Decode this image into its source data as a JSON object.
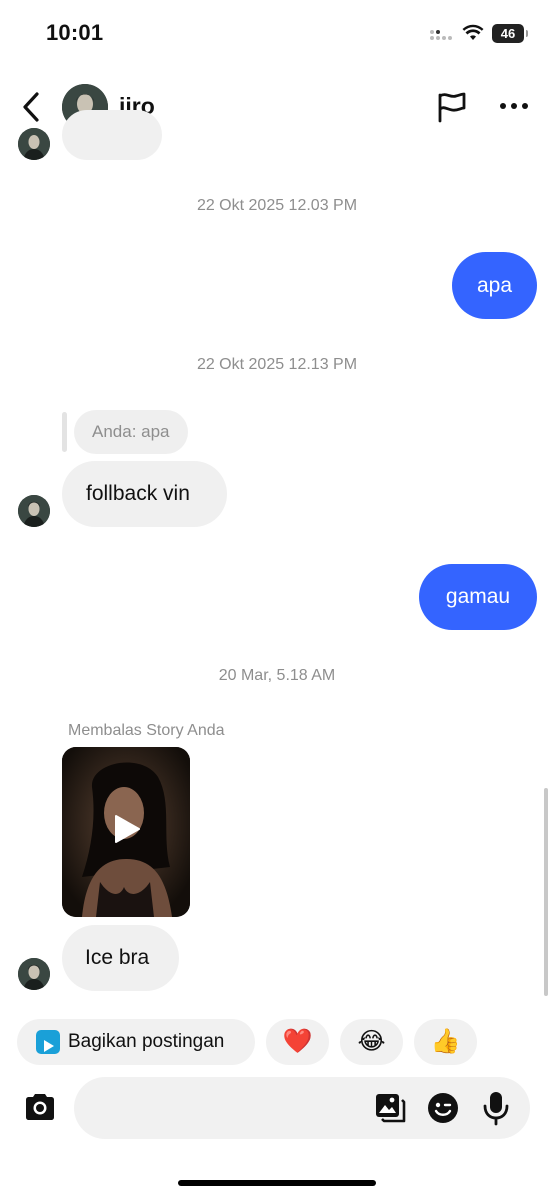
{
  "status_bar": {
    "time": "10:01",
    "battery": "46"
  },
  "header": {
    "username": "jiro"
  },
  "messages": {
    "ts1": "22 Okt 2025 12.03 PM",
    "out1": "apa",
    "ts2": "22 Okt 2025 12.13 PM",
    "reply_quote": "Anda: apa",
    "in1": "follback vin",
    "out2": "gamau",
    "ts3": "20 Mar, 5.18 AM",
    "story_reply_label": "Membalas Story Anda",
    "in2": "Ice bra"
  },
  "quick_replies": {
    "share_post": "Bagikan postingan",
    "emoji1": "❤️",
    "emoji2": "😂",
    "emoji3": "👍"
  },
  "colors": {
    "outgoing_bubble": "#3464ff",
    "incoming_bubble": "#f0f0f0",
    "timestamp": "#8e8e8e",
    "share_icon": "#1aa0d8"
  },
  "icons": [
    "back-arrow-icon",
    "flag-icon",
    "more-icon",
    "play-icon",
    "camera-icon",
    "gallery-icon",
    "sticker-icon",
    "microphone-icon",
    "wifi-icon",
    "signal-icon",
    "battery-icon"
  ]
}
